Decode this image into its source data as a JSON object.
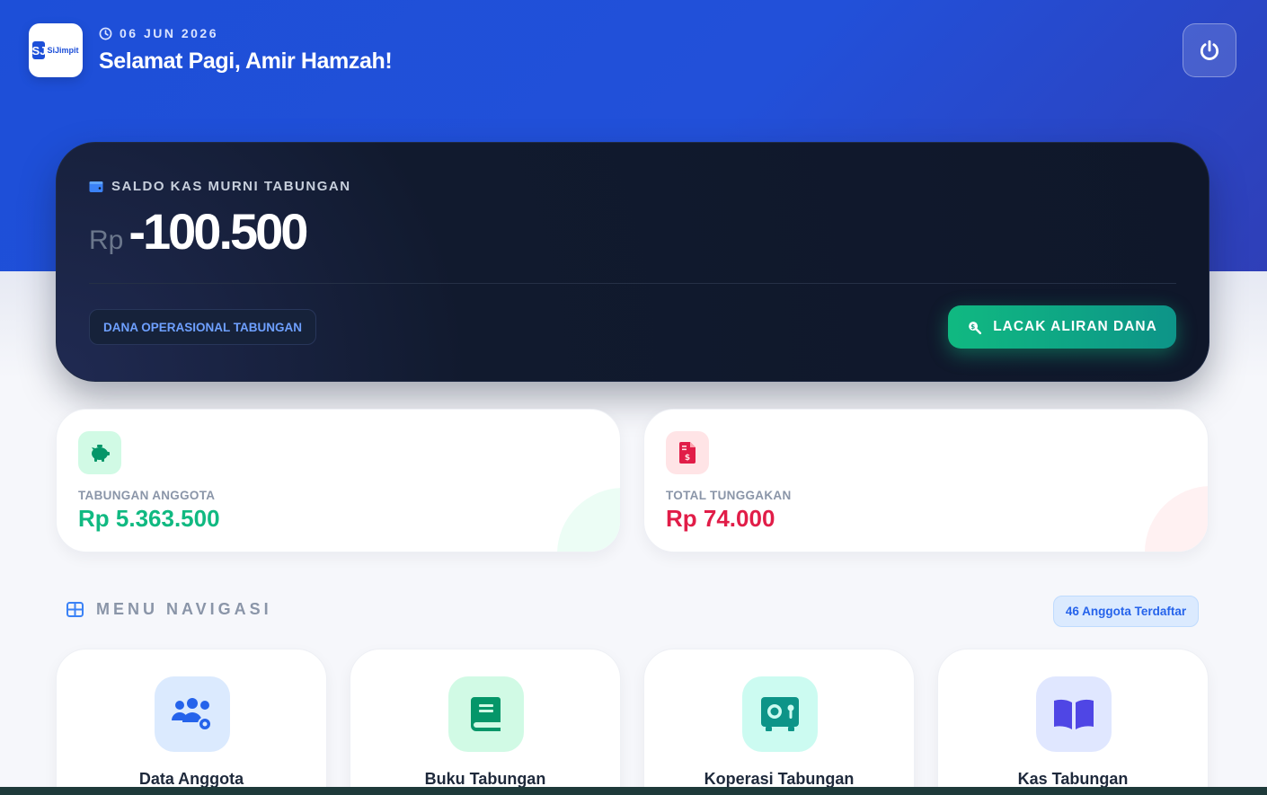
{
  "header": {
    "logo_text": "SiJimpit",
    "logo_mark": "SJ",
    "date": "06 JUN 2026",
    "greeting": "Selamat Pagi, Amir Hamzah!",
    "power_icon": "power-icon"
  },
  "balance": {
    "label": "SALDO KAS MURNI TABUNGAN",
    "currency": "Rp",
    "amount": "-100.500",
    "chip": "DANA OPERASIONAL TABUNGAN",
    "track_button": "LACAK ALIRAN DANA",
    "icons": {
      "label": "wallet-icon",
      "button": "search-dollar-icon"
    }
  },
  "stats": [
    {
      "label": "TABUNGAN ANGGOTA",
      "value": "Rp 5.363.500",
      "icon": "piggy-bank-icon",
      "color": "#10b981"
    },
    {
      "label": "TOTAL TUNGGAKAN",
      "value": "Rp 74.000",
      "icon": "invoice-dollar-icon",
      "color": "#e11d48"
    }
  ],
  "nav": {
    "title": "MENU NAVIGASI",
    "badge": "46 Anggota Terdaftar",
    "items": [
      {
        "label": "Data Anggota",
        "icon": "users-cog-icon",
        "color": "#2563eb"
      },
      {
        "label": "Buku Tabungan",
        "icon": "book-icon",
        "color": "#059669"
      },
      {
        "label": "Koperasi Tabungan",
        "icon": "vault-icon",
        "color": "#0d9488"
      },
      {
        "label": "Kas Tabungan",
        "icon": "book-open-icon",
        "color": "#4f46e5"
      }
    ]
  }
}
